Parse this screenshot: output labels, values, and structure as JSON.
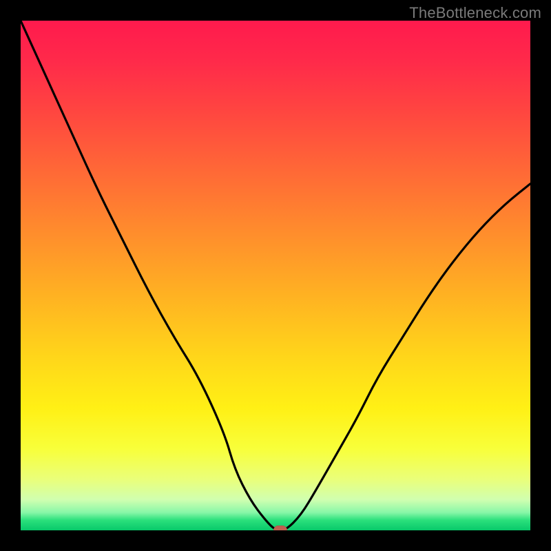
{
  "watermark": "TheBottleneck.com",
  "colors": {
    "marker": "#c06050",
    "curve": "#000000",
    "frame": "#000000"
  },
  "chart_data": {
    "type": "line",
    "title": "",
    "xlabel": "",
    "ylabel": "",
    "xlim": [
      0,
      100
    ],
    "ylim": [
      0,
      100
    ],
    "x": [
      0,
      5,
      10,
      15,
      20,
      25,
      30,
      35,
      40,
      42,
      45,
      48,
      50,
      52,
      55,
      58,
      62,
      66,
      70,
      75,
      80,
      85,
      90,
      95,
      100
    ],
    "y": [
      100,
      89,
      78,
      67,
      57,
      47,
      38,
      30,
      19,
      12,
      6,
      2,
      0,
      0,
      3,
      8,
      15,
      22,
      30,
      38,
      46,
      53,
      59,
      64,
      68
    ],
    "marker": {
      "x": 51,
      "y": 0
    },
    "grid": false,
    "legend": null
  }
}
